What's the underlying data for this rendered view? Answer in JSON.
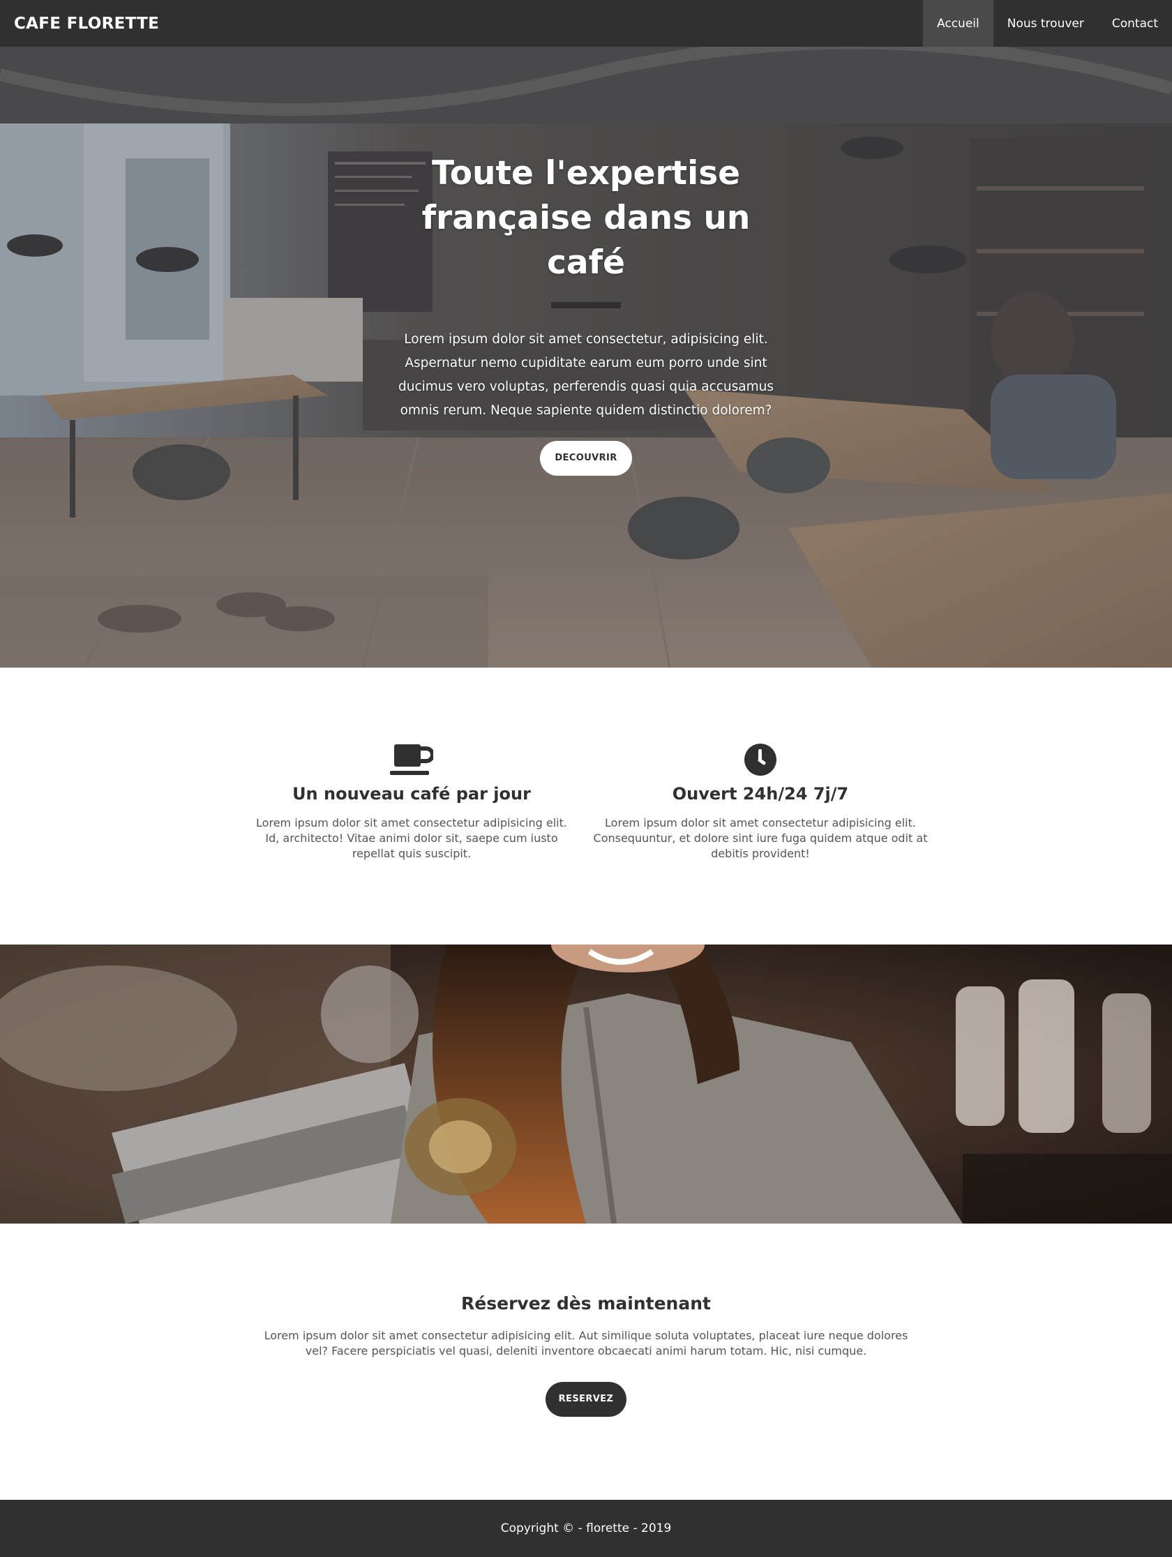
{
  "navbar": {
    "brand": "CAFE FLORETTE",
    "links": [
      {
        "label": "Accueil",
        "active": true
      },
      {
        "label": "Nous trouver",
        "active": false
      },
      {
        "label": "Contact",
        "active": false
      }
    ]
  },
  "hero": {
    "title_line1": "Toute l'expertise",
    "title_line2": "française dans un café",
    "text": "Lorem ipsum dolor sit amet consectetur, adipisicing elit. Aspernatur nemo cupiditate earum eum porro unde sint ducimus vero voluptas, perferendis quasi quia accusamus omnis rerum. Neque sapiente quidem distinctio dolorem?",
    "button_label": "DECOUVRIR"
  },
  "features": [
    {
      "icon": "coffee-cup-icon",
      "title": "Un nouveau café par jour",
      "text": "Lorem ipsum dolor sit amet consectetur adipisicing elit. Id, architecto! Vitae animi dolor sit, saepe cum iusto repellat quis suscipit."
    },
    {
      "icon": "clock-icon",
      "title": "Ouvert 24h/24 7j/7",
      "text": "Lorem ipsum dolor sit amet consectetur adipisicing elit. Consequuntur, et dolore sint iure fuga quidem atque odit at debitis provident!"
    }
  ],
  "reserve": {
    "title": "Réservez dès maintenant",
    "text": "Lorem ipsum dolor sit amet consectetur adipisicing elit. Aut similique soluta voluptates, placeat iure neque dolores vel? Facere perspiciatis vel quasi, deleniti inventore obcaecati animi harum totam. Hic, nisi cumque.",
    "button_label": "RESERVEZ"
  },
  "footer": {
    "copyright": "Copyright © - florette - 2019"
  },
  "colors": {
    "dark": "#303030",
    "nav_active": "#4a4a4a",
    "text_muted": "#555555",
    "white": "#ffffff"
  }
}
